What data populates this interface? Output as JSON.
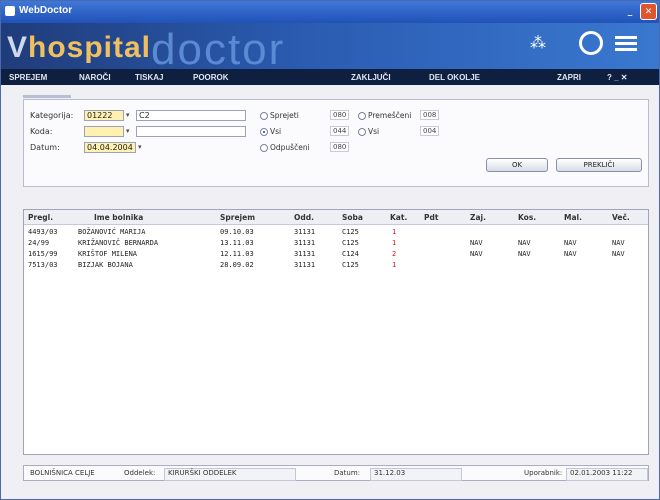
{
  "window": {
    "title": "WebDoctor",
    "minimize": "_",
    "close": "✕"
  },
  "banner": {
    "logo_left_a": "V",
    "logo_left_b": "hospital",
    "logo_right": "doctor"
  },
  "menu": [
    "SPREJEM",
    "NAROČI",
    "TISKAJ",
    "POOROK",
    "ZAKLJUČI",
    "DEL OKOLJE",
    "ZAPRI",
    "? _ ✕"
  ],
  "form": {
    "kategorija_label": "Kategorija:",
    "kategorija_value": "01222",
    "kategorija_extra": "C2",
    "koda_label": "Koda:",
    "koda_value": "",
    "datum_label": "Datum:",
    "datum_value": "04.04.2004",
    "radios": [
      {
        "label": "Sprejeti",
        "value": "080",
        "checked": false
      },
      {
        "label": "Vsi",
        "value": "044",
        "checked": true
      },
      {
        "label": "Odpuščeni",
        "value": "080",
        "checked": false
      },
      {
        "label": "Premeščeni",
        "value": "008",
        "checked": false
      },
      {
        "label": "Vsi",
        "value": "004",
        "checked": false
      }
    ],
    "btn_ok": "OK",
    "btn_cancel": "PREKLIČI"
  },
  "table": {
    "headers": [
      "Pregl.",
      "Ime bolnika",
      "Sprejem",
      "Odd.",
      "Soba",
      "Kat.",
      "Pdt",
      "Zaj.",
      "Kos.",
      "Mal.",
      "Več."
    ],
    "rows": [
      [
        "4493/03",
        "BOŽANOVIĆ MARIJA",
        "09.10.03",
        "31131",
        "C125",
        "1",
        "",
        "",
        "",
        "",
        ""
      ],
      [
        "24/99",
        "KRIŽANOVIČ BERNARDA",
        "13.11.03",
        "31131",
        "C125",
        "1",
        "",
        "NAV",
        "NAV",
        "NAV",
        "NAV"
      ],
      [
        "1615/99",
        "KRIŠTOF MILENA",
        "12.11.03",
        "31131",
        "C124",
        "2",
        "",
        "NAV",
        "NAV",
        "NAV",
        "NAV"
      ],
      [
        "7513/03",
        "BIZJAK BOJANA",
        "28.09.02",
        "31131",
        "C125",
        "1",
        "",
        "",
        "",
        "",
        ""
      ]
    ]
  },
  "status": {
    "left": "BOLNIŠNICA CELJE",
    "odd_label": "Oddelek:",
    "odd_value": "KIRURŠKI ODDELEK",
    "date_label": "Datum:",
    "date_value": "31.12.03",
    "user_label": "Uporabnik:",
    "user_value": "02.01.2003 11:22"
  }
}
